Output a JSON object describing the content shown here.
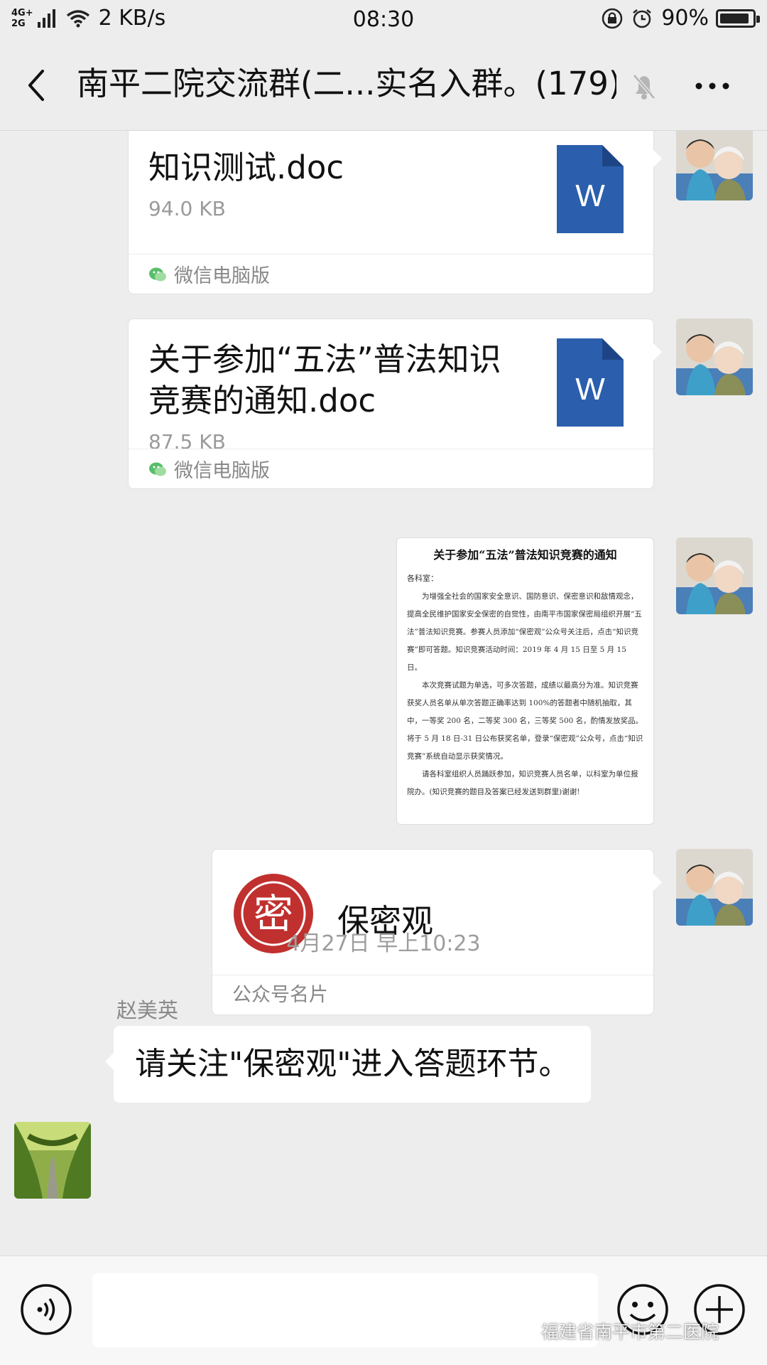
{
  "status_bar": {
    "network_type_top": "4G+",
    "network_type_bottom": "2G",
    "speed": "2 KB/s",
    "time": "08:30",
    "battery": "90%",
    "battery_level": 0.9
  },
  "header": {
    "title": "南平二院交流群(二...实名入群。(179)"
  },
  "messages": {
    "file1": {
      "name": "知识测试.doc",
      "size": "94.0 KB",
      "source": "微信电脑版",
      "icon_letter": "W"
    },
    "file2": {
      "name": "关于参加“五法”普法知识竞赛的通知.doc",
      "size": "87.5 KB",
      "source": "微信电脑版",
      "icon_letter": "W"
    },
    "doc_image": {
      "title": "关于参加“五法”普法知识竞赛的通知",
      "greeting": "各科室：",
      "para1": "为增强全社会的国家安全意识、国防意识、保密意识和敌情观念，提高全民维护国家安全保密的自觉性，由南平市国家保密局组织开展“五法”普法知识竞赛。参赛人员添加“保密观”公众号关注后，点击“知识竞赛”即可答题。知识竞赛活动时间：2019 年 4 月 15 日至 5 月 15 日。",
      "para2": "本次竞赛试题为单选，可多次答题，成绩以最高分为准。知识竞赛获奖人员名单从单次答题正确率达到 100%的答题者中随机抽取，其中，一等奖 200 名，二等奖 300 名，三等奖 500 名，酌情发放奖品。将于 5 月 18 日-31 日公布获奖名单，登录“保密观”公众号，点击“知识竞赛”系统自动显示获奖情况。",
      "para3": "请各科室组织人员踊跃参加，知识竞赛人员名单，以科室为单位报院办。(知识竞赛的题目及答案已经发送到群里)谢谢!"
    },
    "official_account": {
      "name": "保密观",
      "label": "公众号名片",
      "logo_char": "密"
    },
    "timestamp": "4月27日 早上10:23",
    "text_message": {
      "sender": "赵美英",
      "text": "请关注\"保密观\"进入答题环节。"
    }
  },
  "input": {
    "value": "",
    "placeholder": ""
  },
  "watermark": {
    "text": "福建省南平市第二医院"
  },
  "colors": {
    "background": "#ededed",
    "word_blue": "#2b5fad",
    "seal_red": "#c0302e"
  },
  "icons": [
    "wifi-icon",
    "lock-rotate-icon",
    "alarm-icon",
    "battery-icon",
    "back-arrow-icon",
    "mute-bell-icon",
    "more-icon",
    "voice-icon",
    "emoji-icon",
    "plus-icon",
    "wechat-icon"
  ]
}
